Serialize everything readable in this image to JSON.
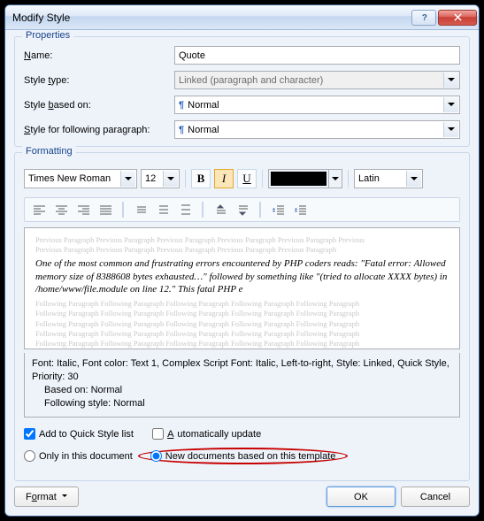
{
  "titlebar": {
    "title": "Modify Style"
  },
  "properties": {
    "legend": "Properties",
    "name_label_pre": "",
    "name_label_ul": "N",
    "name_label_post": "ame:",
    "name_value": "Quote",
    "type_label_pre": "Style ",
    "type_label_ul": "t",
    "type_label_post": "ype:",
    "type_value": "Linked (paragraph and character)",
    "based_label_pre": "Style ",
    "based_label_ul": "b",
    "based_label_post": "ased on:",
    "based_value": "Normal",
    "follow_label_pre": "",
    "follow_label_ul": "S",
    "follow_label_post": "tyle for following paragraph:",
    "follow_value": "Normal"
  },
  "formatting": {
    "legend": "Formatting",
    "font": "Times New Roman",
    "size": "12",
    "bold": "B",
    "italic": "I",
    "underline": "U",
    "lang": "Latin"
  },
  "preview": {
    "ghost_prev": "Previous Paragraph Previous Paragraph Previous Paragraph Previous Paragraph Previous Paragraph Previous",
    "ghost_prev2": "Previous Paragraph Previous Paragraph Previous Paragraph Previous Paragraph Previous Paragraph",
    "sample": "One of the most common and frustrating errors encountered by PHP coders reads: \"Fatal error: Allowed memory size of 8388608 bytes exhausted…\" followed by something like \"(tried to allocate XXXX bytes) in /home/www/file.module on line 12.\" This fatal PHP e",
    "ghost_next": "Following Paragraph Following Paragraph Following Paragraph Following Paragraph Following Paragraph"
  },
  "desc": {
    "line1": "Font: Italic, Font color: Text 1, Complex Script Font: Italic, Left-to-right, Style: Linked, Quick Style,",
    "line2": "Priority: 30",
    "line3": "Based on: Normal",
    "line4": "Following style: Normal"
  },
  "options": {
    "quickstyle": "Add to Quick Style list",
    "autoupdate": "Automatically update",
    "onlydoc": "Only in this document",
    "newdocs": "New documents based on this template"
  },
  "buttons": {
    "format_pre": "F",
    "format_ul": "o",
    "format_post": "rmat",
    "ok": "OK",
    "cancel": "Cancel"
  }
}
